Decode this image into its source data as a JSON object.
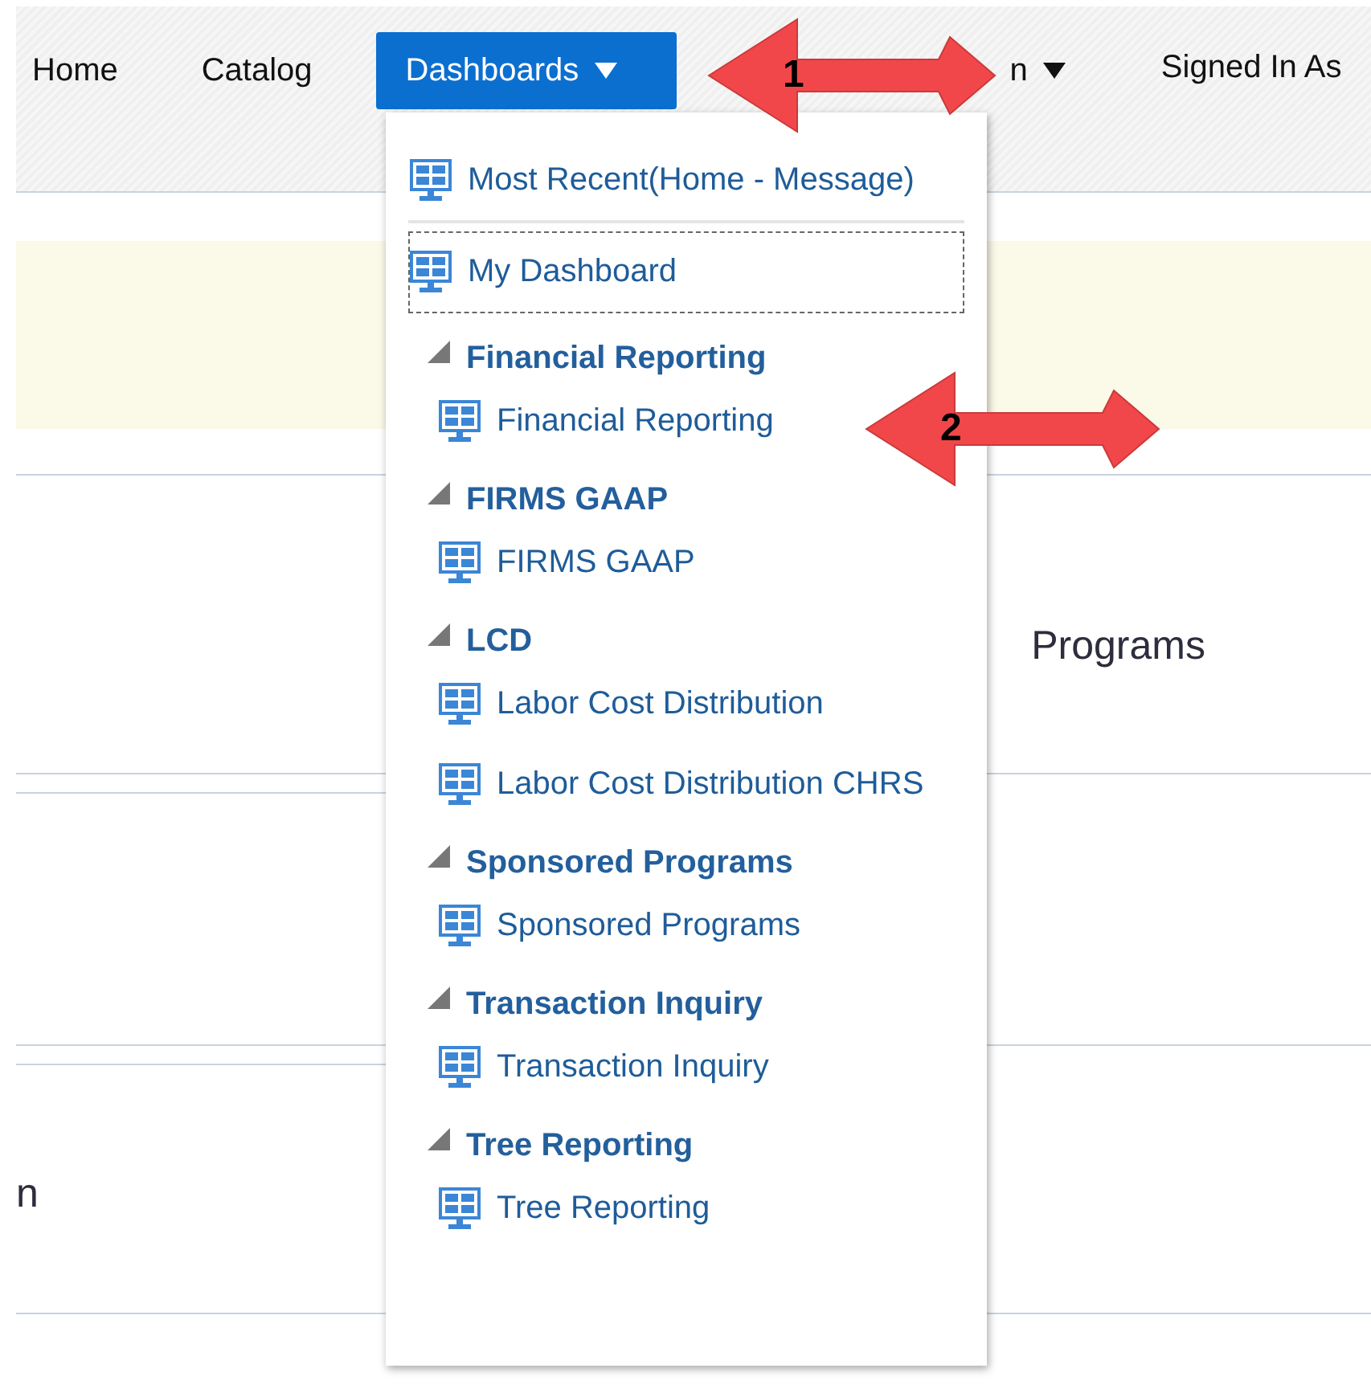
{
  "nav": {
    "items": [
      {
        "label": "Home",
        "selected": false,
        "has_menu": false
      },
      {
        "label": "Catalog",
        "selected": false,
        "has_menu": false
      },
      {
        "label": "Dashboards",
        "selected": true,
        "has_menu": true
      },
      {
        "label": "n",
        "selected": false,
        "has_menu": true
      },
      {
        "label": "Signed In As",
        "selected": false,
        "has_menu": false
      }
    ]
  },
  "page": {
    "heading_fragment": "Programs",
    "left_fragment": "n"
  },
  "dashboards_menu": {
    "recent": {
      "label": "Most Recent(Home - Message)"
    },
    "favorite": {
      "label": "My Dashboard",
      "focused": true
    },
    "groups": [
      {
        "title": "Financial Reporting",
        "expanded": true,
        "children": [
          {
            "label": "Financial Reporting"
          }
        ]
      },
      {
        "title": "FIRMS GAAP",
        "expanded": true,
        "children": [
          {
            "label": "FIRMS GAAP"
          }
        ]
      },
      {
        "title": "LCD",
        "expanded": true,
        "children": [
          {
            "label": "Labor Cost Distribution"
          },
          {
            "label": "Labor Cost Distribution CHRS"
          }
        ]
      },
      {
        "title": "Sponsored Programs",
        "expanded": true,
        "children": [
          {
            "label": "Sponsored Programs"
          }
        ]
      },
      {
        "title": "Transaction Inquiry",
        "expanded": true,
        "children": [
          {
            "label": "Transaction Inquiry"
          }
        ]
      },
      {
        "title": "Tree Reporting",
        "expanded": true,
        "children": [
          {
            "label": "Tree Reporting"
          }
        ]
      }
    ]
  },
  "annotations": [
    {
      "label": "1"
    },
    {
      "label": "2"
    }
  ]
}
